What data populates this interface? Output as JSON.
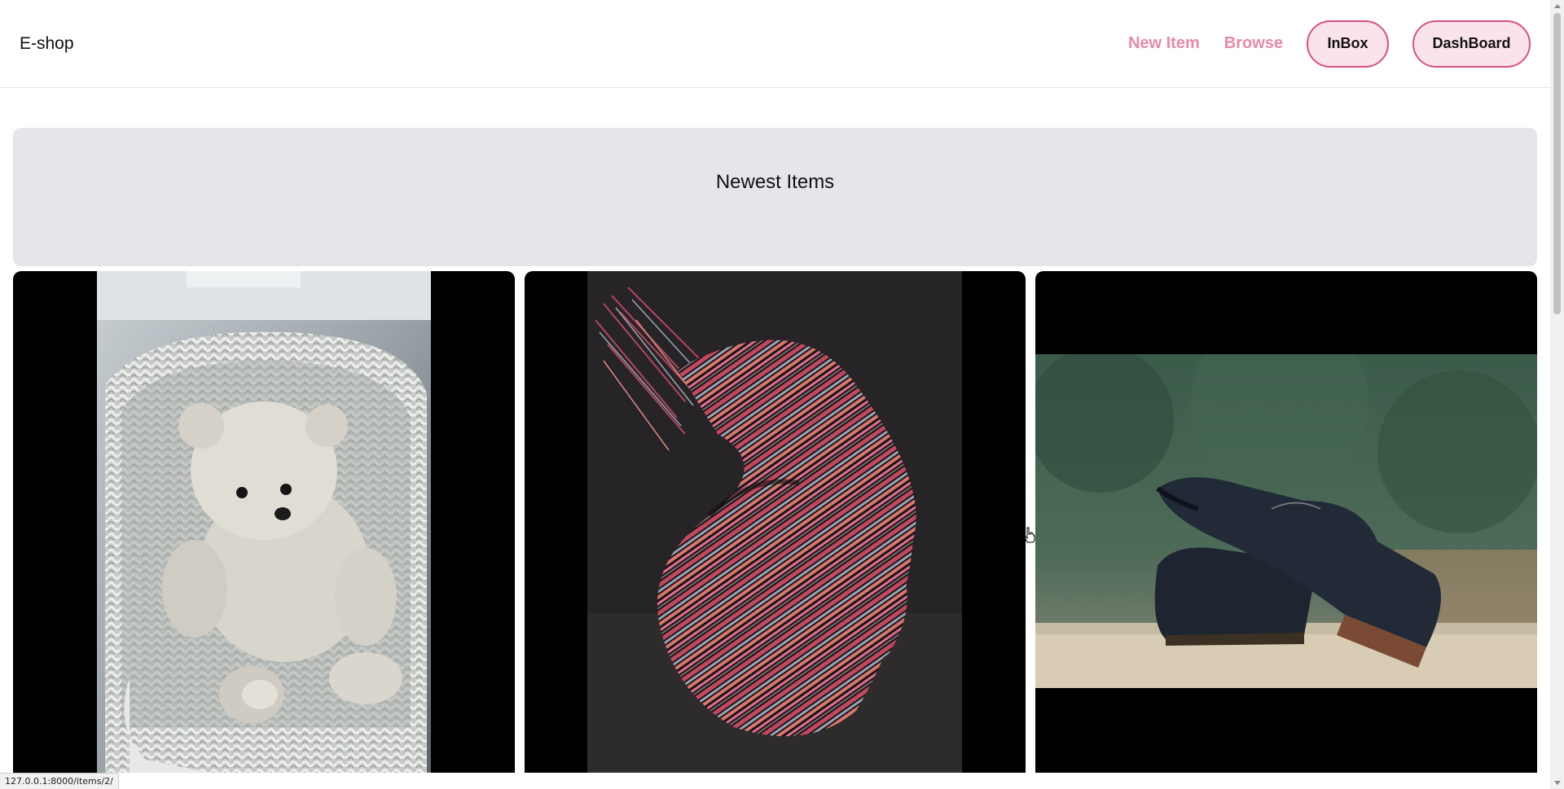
{
  "navbar": {
    "brand": "E-shop",
    "links": [
      {
        "label": "New Item"
      },
      {
        "label": "Browse"
      }
    ],
    "buttons": [
      {
        "label": "InBox"
      },
      {
        "label": "DashBoard"
      }
    ]
  },
  "hero": {
    "title": "Newest Items"
  },
  "items": [
    {
      "image_icon": "teddy-bear-in-wicker-chair"
    },
    {
      "image_icon": "striped-scarf"
    },
    {
      "image_icon": "black-leather-shoes"
    }
  ],
  "statusbar": {
    "url": "127.0.0.1:8000/items/2/"
  },
  "colors": {
    "accent_link": "#e88aa6",
    "pill_border": "#d94f86",
    "pill_bg": "#fbe3ec",
    "hero_bg": "#e5e6ea",
    "card_bg": "#000000"
  }
}
